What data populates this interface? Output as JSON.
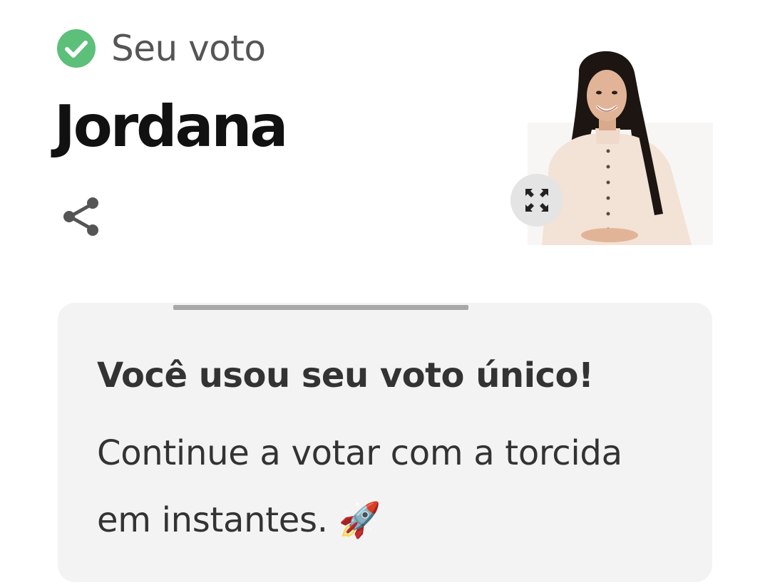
{
  "status": {
    "icon": "check-circle-icon",
    "label": "Seu voto",
    "color": "#5cbf7a"
  },
  "candidate": {
    "name": "Jordana",
    "photo_alt": "Jordana"
  },
  "actions": {
    "share_icon": "share-icon",
    "expand_icon": "expand-icon"
  },
  "message": {
    "title": "Você usou seu voto único!",
    "body": "Continue a votar com a torcida em instantes. 🚀"
  },
  "colors": {
    "card_background": "#f3f3f3",
    "title_text": "#111111",
    "body_text": "#333333"
  }
}
